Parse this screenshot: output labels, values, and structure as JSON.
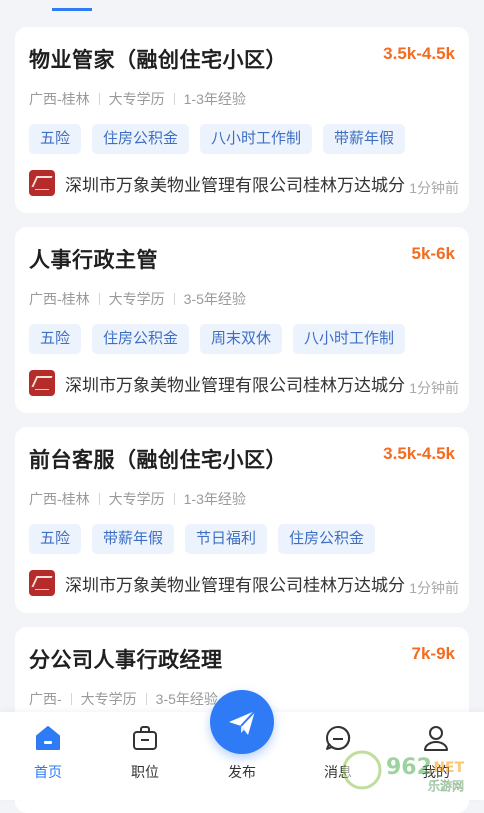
{
  "jobs": [
    {
      "title": "物业管家（融创住宅小区）",
      "salary": "3.5k-4.5k",
      "location": "广西-桂林",
      "education": "大专学历",
      "experience": "1-3年经验",
      "tags": [
        "五险",
        "住房公积金",
        "八小时工作制",
        "带薪年假"
      ],
      "company": "深圳市万象美物业管理有限公司桂林万达城分",
      "time": "1分钟前"
    },
    {
      "title": "人事行政主管",
      "salary": "5k-6k",
      "location": "广西-桂林",
      "education": "大专学历",
      "experience": "3-5年经验",
      "tags": [
        "五险",
        "住房公积金",
        "周末双休",
        "八小时工作制"
      ],
      "company": "深圳市万象美物业管理有限公司桂林万达城分",
      "time": "1分钟前"
    },
    {
      "title": "前台客服（融创住宅小区）",
      "salary": "3.5k-4.5k",
      "location": "广西-桂林",
      "education": "大专学历",
      "experience": "1-3年经验",
      "tags": [
        "五险",
        "带薪年假",
        "节日福利",
        "住房公积金"
      ],
      "company": "深圳市万象美物业管理有限公司桂林万达城分",
      "time": "1分钟前"
    },
    {
      "title": "分公司人事行政经理",
      "salary": "7k-9k",
      "location": "广西-",
      "education": "大专学历",
      "experience": "3-5年经验",
      "tags": [],
      "company": "",
      "time": ""
    }
  ],
  "nav": {
    "home": "首页",
    "jobs": "职位",
    "publish": "发布",
    "messages": "消息",
    "profile": "我的"
  },
  "colors": {
    "accent": "#2f7bf5",
    "salary": "#f26d21",
    "tag_bg": "#edf3fd",
    "tag_text": "#3d6fc4"
  },
  "watermark": {
    "brand": "962",
    "suffix": ".NET",
    "sub": "乐游网"
  }
}
